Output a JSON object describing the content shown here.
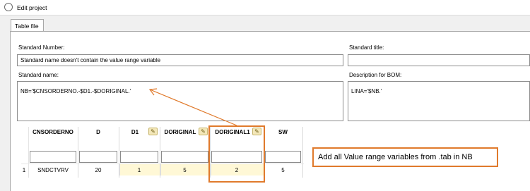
{
  "window": {
    "title": "Edit project"
  },
  "tabs": [
    {
      "label": "Table file"
    }
  ],
  "form": {
    "standard_number_label": "Standard Number:",
    "standard_number_value": "Standard name doesn't contain the value range variable",
    "standard_title_label": "Standard title:",
    "standard_title_value": "",
    "standard_name_label": "Standard name:",
    "standard_name_value": "NB='$CNSORDERNO.-$D1.-$DORIGINAL.'",
    "bom_label": "Description for BOM:",
    "bom_value": "LINA='$NB.'"
  },
  "table": {
    "headers": [
      "CNSORDERNO",
      "D",
      "D1",
      "DORIGINAL",
      "DORIGINAL1",
      "SW"
    ],
    "editable_columns": [
      "D1",
      "DORIGINAL",
      "DORIGINAL1"
    ],
    "rows": [
      {
        "index": "1",
        "cells": [
          "SNDCTVRV",
          "20",
          "1",
          "5",
          "2",
          "5"
        ]
      }
    ]
  },
  "annotation": {
    "note": "Add all Value range variables from .tab in NB",
    "highlight_color": "#e07a2c"
  },
  "icons": [
    "window-icon",
    "pencil-icon"
  ]
}
